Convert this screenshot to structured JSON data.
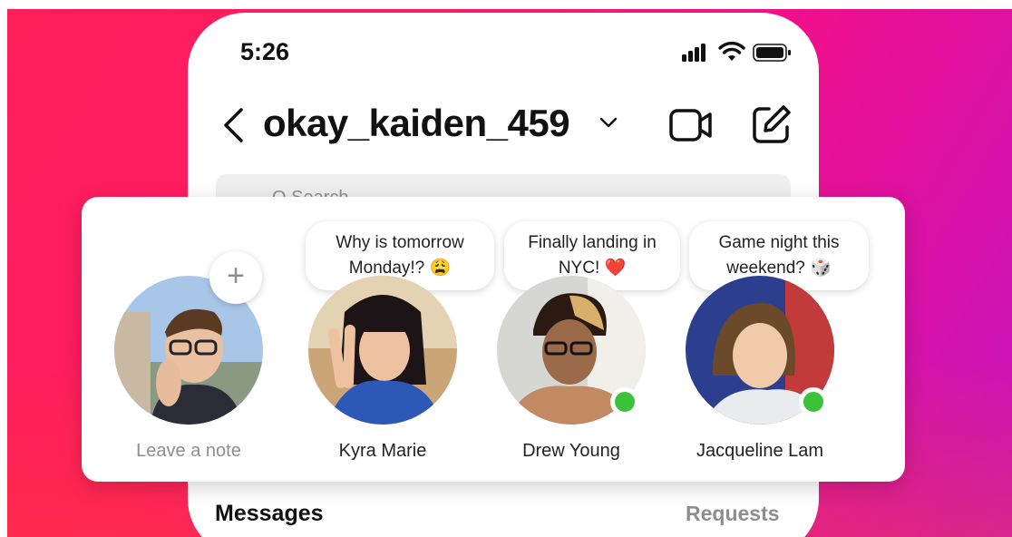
{
  "status_bar": {
    "time": "5:26"
  },
  "header": {
    "username": "okay_kaiden_459"
  },
  "search": {
    "placeholder": "Q Search"
  },
  "notes": [
    {
      "name": "Leave a note",
      "note": ""
    },
    {
      "name": "Kyra Marie",
      "note": "Why is tomorrow Monday!? 😩"
    },
    {
      "name": "Drew Young",
      "note": "Finally landing in NYC! ❤️"
    },
    {
      "name": "Jacqueline Lam",
      "note": "Game night this weekend? 🎲"
    }
  ],
  "add_note_symbol": "+",
  "sections": {
    "messages": "Messages",
    "requests": "Requests"
  },
  "colors": {
    "gradient_start": "#ff1f5a",
    "gradient_end": "#c414c0",
    "online": "#3cc13b",
    "muted_text": "#8e8e8e"
  },
  "icons": [
    "signal-icon",
    "wifi-icon",
    "battery-icon",
    "back-icon",
    "chevron-down-icon",
    "video-call-icon",
    "compose-icon",
    "search-icon"
  ]
}
